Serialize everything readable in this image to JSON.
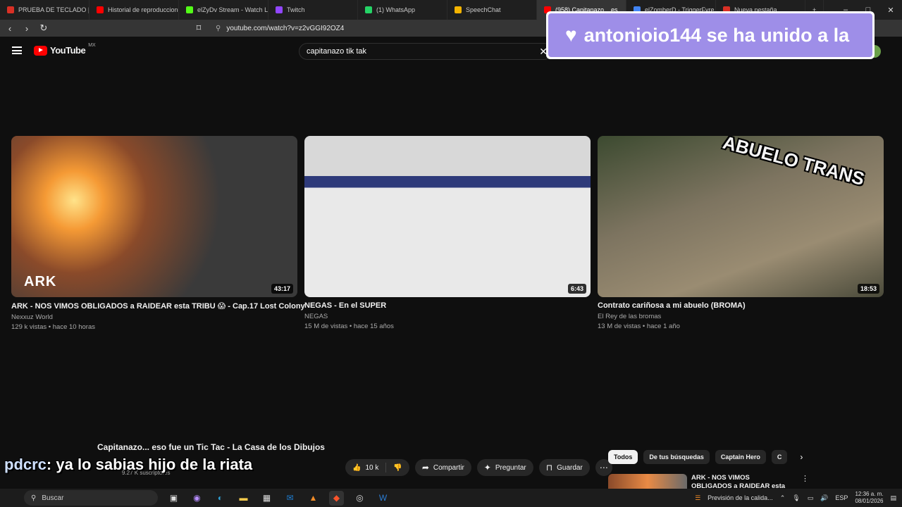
{
  "browser": {
    "tabs": [
      {
        "label": "PRUEBA DE TECLADO | On",
        "favicon_color": "#d93025"
      },
      {
        "label": "Historial de reproduccione",
        "favicon_color": "#ff0000"
      },
      {
        "label": "elZyDv Stream - Watch Liv",
        "favicon_color": "#53fc18"
      },
      {
        "label": "Twitch",
        "favicon_color": "#9146ff"
      },
      {
        "label": "(1) WhatsApp",
        "favicon_color": "#25d366"
      },
      {
        "label": "SpeechChat",
        "favicon_color": "#f4b400"
      },
      {
        "label": "(958) Capitanazo... es",
        "favicon_color": "#ff0000",
        "active": true
      },
      {
        "label": "elZomberD - TriggerFyre",
        "favicon_color": "#4285f4"
      },
      {
        "label": "Nueva pestaña",
        "favicon_color": "#d93025"
      }
    ],
    "new_tab": "+",
    "url": "youtube.com/watch?v=z2vGGI92OZ4"
  },
  "youtube": {
    "logo_text": "YouTube",
    "country": "MX",
    "search_value": "capitanazo tik tak"
  },
  "notification": {
    "text": "antonioio144 se ha unido a la"
  },
  "videos": [
    {
      "title": "ARK - NOS VIMOS OBLIGADOS a RAIDEAR esta TRIBU 😱 - Cap.17 Lost Colony",
      "channel": "Nexxuz World",
      "meta": "129 k vistas • hace 10 horas",
      "duration": "43:17",
      "thumb_text": "ARK"
    },
    {
      "title": "NEGAS - En el SUPER",
      "channel": "NEGAS",
      "meta": "15 M de vistas • hace 15 años",
      "duration": "6:43",
      "thumb_text": ""
    },
    {
      "title": "Contrato cariñosa a mi abuelo (BROMA)",
      "channel": "El Rey de las bromas",
      "meta": "13 M de vistas • hace 1 año",
      "duration": "18:53",
      "thumb_text": "ABUELO TRANS"
    }
  ],
  "watch": {
    "title": "Capitanazo... eso fue un Tic Tac - La Casa de los Dibujos",
    "subscribers": "9.27 K suscriptores",
    "like_count": "10 k",
    "share_label": "Compartir",
    "ask_label": "Preguntar",
    "save_label": "Guardar"
  },
  "related": {
    "chips": [
      "Todos",
      "De tus búsquedas",
      "Captain Hero",
      "C"
    ],
    "first_title": "ARK - NOS VIMOS OBLIGADOS a RAIDEAR esta TRIBU 😱 -"
  },
  "chat": {
    "user": "pdcrc",
    "message": ": ya lo sabias hijo de la riata"
  },
  "taskbar": {
    "search_placeholder": "Buscar",
    "weather_text": "Previsión de la calida...",
    "language": "ESP",
    "time": "12:36 a. m.",
    "date": "08/01/2026"
  }
}
